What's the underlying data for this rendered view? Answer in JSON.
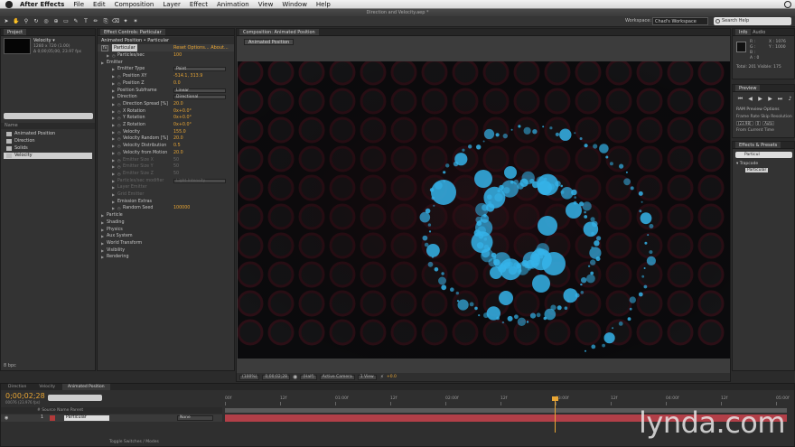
{
  "menubar": {
    "app": "After Effects",
    "items": [
      "File",
      "Edit",
      "Composition",
      "Layer",
      "Effect",
      "Animation",
      "View",
      "Window",
      "Help"
    ]
  },
  "window_title": "Direction and Velocity.aep *",
  "toolbar": {
    "workspace_label": "Workspace:",
    "workspace_value": "Chad's Workspace",
    "search_placeholder": "Search Help"
  },
  "project": {
    "tab": "Project",
    "comp_name": "Velocity ▾",
    "comp_size": "1280 x 720 (1.00)",
    "comp_duration": "Δ 0;00;05;00, 23.97 fps",
    "list_header": "Name",
    "items": [
      {
        "label": "Animated Position",
        "selected": false
      },
      {
        "label": "Direction",
        "selected": false
      },
      {
        "label": "Solids",
        "selected": false
      },
      {
        "label": "Velocity",
        "selected": true
      }
    ],
    "bpc": "8 bpc"
  },
  "effect_controls": {
    "tab": "Effect Controls: Particular",
    "header": "Animated Position • Particular",
    "effect_name": "Particular",
    "effect_options": "Reset  Options...  About...",
    "rows": [
      {
        "label": "Particles/sec",
        "value": "100",
        "indent": 1,
        "type": "val",
        "dim": false
      },
      {
        "label": "Emitter",
        "value": "",
        "indent": 0,
        "type": "none",
        "dim": false
      },
      {
        "label": "Emitter Type",
        "value": "Point",
        "indent": 2,
        "type": "box",
        "dim": false
      },
      {
        "label": "Position XY",
        "value": "-514.1, 313.9",
        "indent": 2,
        "type": "val",
        "dim": false
      },
      {
        "label": "Position Z",
        "value": "0.0",
        "indent": 2,
        "type": "val",
        "dim": false
      },
      {
        "label": "Position Subframe",
        "value": "Linear",
        "indent": 2,
        "type": "box",
        "dim": false
      },
      {
        "label": "Direction",
        "value": "Directional",
        "indent": 2,
        "type": "box",
        "dim": false
      },
      {
        "label": "Direction Spread [%]",
        "value": "20.0",
        "indent": 2,
        "type": "val",
        "dim": false
      },
      {
        "label": "X Rotation",
        "value": "0x+0.0°",
        "indent": 2,
        "type": "val",
        "dim": false
      },
      {
        "label": "Y Rotation",
        "value": "0x+0.0°",
        "indent": 2,
        "type": "val",
        "dim": false
      },
      {
        "label": "Z Rotation",
        "value": "0x+0.0°",
        "indent": 2,
        "type": "val",
        "dim": false
      },
      {
        "label": "Velocity",
        "value": "155.0",
        "indent": 2,
        "type": "val",
        "dim": false
      },
      {
        "label": "Velocity Random [%]",
        "value": "20.0",
        "indent": 2,
        "type": "val",
        "dim": false
      },
      {
        "label": "Velocity Distribution",
        "value": "0.5",
        "indent": 2,
        "type": "val",
        "dim": false
      },
      {
        "label": "Velocity from Motion",
        "value": "20.0",
        "indent": 2,
        "type": "val",
        "dim": false
      },
      {
        "label": "Emitter Size X",
        "value": "50",
        "indent": 2,
        "type": "val",
        "dim": true
      },
      {
        "label": "Emitter Size Y",
        "value": "50",
        "indent": 2,
        "type": "val",
        "dim": true
      },
      {
        "label": "Emitter Size Z",
        "value": "50",
        "indent": 2,
        "type": "val",
        "dim": true
      },
      {
        "label": "Particles/sec modifier",
        "value": "Light Intensity",
        "indent": 2,
        "type": "box",
        "dim": true
      },
      {
        "label": "Layer Emitter",
        "value": "",
        "indent": 2,
        "type": "none",
        "dim": true
      },
      {
        "label": "Grid Emitter",
        "value": "",
        "indent": 2,
        "type": "none",
        "dim": true
      },
      {
        "label": "Emission Extras",
        "value": "",
        "indent": 2,
        "type": "none",
        "dim": false
      },
      {
        "label": "Random Seed",
        "value": "100000",
        "indent": 2,
        "type": "val",
        "dim": false
      },
      {
        "label": "Particle",
        "value": "",
        "indent": 0,
        "type": "none",
        "dim": false
      },
      {
        "label": "Shading",
        "value": "",
        "indent": 0,
        "type": "none",
        "dim": false
      },
      {
        "label": "Physics",
        "value": "",
        "indent": 0,
        "type": "none",
        "dim": false
      },
      {
        "label": "Aux System",
        "value": "",
        "indent": 0,
        "type": "none",
        "dim": false
      },
      {
        "label": "World Transform",
        "value": "",
        "indent": 0,
        "type": "none",
        "dim": false
      },
      {
        "label": "Visibility",
        "value": "",
        "indent": 0,
        "type": "none",
        "dim": false
      },
      {
        "label": "Rendering",
        "value": "",
        "indent": 0,
        "type": "none",
        "dim": false
      }
    ]
  },
  "composition": {
    "tab": "Composition: Animated Position",
    "subtab": "Animated Position",
    "status": {
      "zoom": "(100%)",
      "timecode": "0;00;02;28",
      "resolution": "(Half)",
      "camera": "Active Camera",
      "views": "1 View",
      "exposure": "+0.0"
    }
  },
  "info": {
    "tab": "Info",
    "tab2": "Audio",
    "rgb": [
      "R :",
      "G :",
      "B :",
      "A : 0"
    ],
    "xy": [
      "X : 1076",
      "Y : 1000"
    ],
    "counts": "Total: 201   Visible: 175"
  },
  "preview": {
    "tab": "Preview",
    "ram_options": "RAM Preview Options",
    "frame_rate_label": "Frame Rate  Skip   Resolution",
    "frame_rate_values": [
      "(23.98)",
      "0",
      "Auto"
    ],
    "from_current": "From Current Time"
  },
  "effects_presets": {
    "tab": "Effects & Presets",
    "search": "Particul",
    "category": "▾ Trapcode",
    "result": "Particular"
  },
  "timeline": {
    "tabs": [
      "Direction",
      "Velocity",
      "Animated Position"
    ],
    "active_tab": 2,
    "timecode": "0;00;02;28",
    "fps": "00076 (23.976 fps)",
    "col_headers": "#   Source Name              Parent",
    "layer": {
      "num": "1",
      "name": "Particular",
      "parent": "None"
    },
    "ruler": [
      "00f",
      "12f",
      "01:00f",
      "12f",
      "02:00f",
      "12f",
      "03:00f",
      "12f",
      "04:00f",
      "12f",
      "05:00f"
    ],
    "toggle": "Toggle Switches / Modes",
    "logo": "lynda.com"
  },
  "colors": {
    "accent": "#e8a534",
    "particle": "#3fb8e8",
    "layer_bar": "#b23f48"
  }
}
